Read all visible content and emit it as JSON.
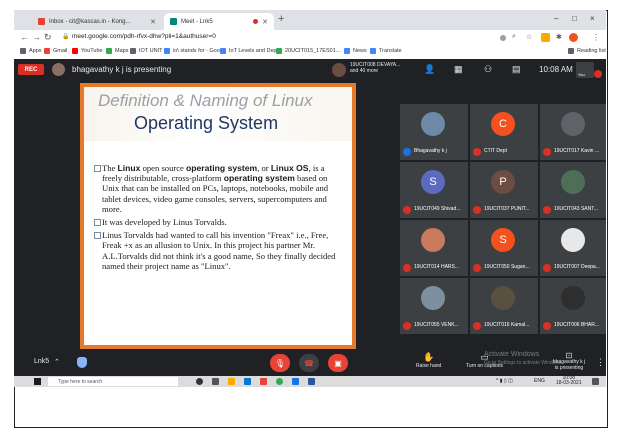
{
  "tabs": {
    "inactive_label": "Inbox - cit@kascas.in - Kong...",
    "active_label": "Meet - Lnk5"
  },
  "browser": {
    "url": "meet.google.com/pdh-rfvx-dhw?pli=1&authuser=0",
    "window_controls": [
      "–",
      "□",
      "×"
    ]
  },
  "bookmarks": [
    {
      "label": "Apps",
      "color": "#5f6368"
    },
    {
      "label": "Gmail",
      "color": "#ea4335"
    },
    {
      "label": "YouTube",
      "color": "#ff0000"
    },
    {
      "label": "Maps",
      "color": "#34a853"
    },
    {
      "label": "IOT UNIT 1",
      "color": "#5f6368"
    },
    {
      "label": "io\\ stands for - Goo...",
      "color": "#4285f4"
    },
    {
      "label": "IoT Levels and Depl...",
      "color": "#4285f4"
    },
    {
      "label": "20UCIT015_17ES01...",
      "color": "#34a853"
    },
    {
      "label": "News",
      "color": "#4285f4"
    },
    {
      "label": "Translate",
      "color": "#4285f4"
    },
    {
      "label": "Reading list",
      "color": "#5f6368"
    }
  ],
  "meet_top": {
    "rec_label": "REC",
    "presenting_text": "bhagavathy k j is presenting",
    "pinned_name_line1": "19UCIT008 DEVAYA...",
    "pinned_name_line2": "and 40 more",
    "clock": "10:08 AM",
    "you_label": "You"
  },
  "slide": {
    "title_line1": "Definition & Naming of Linux",
    "title_line2": "Operating System",
    "bullets": [
      "The <b>Linux</b> open source <b>operating system</b>, or <b>Linux OS</b>, is a freely distributable, cross-platform <b>operating system</b> based on Unix that can be installed on PCs, laptops, notebooks, mobile and tablet devices, video game consoles, servers, supercomputers and more.",
      "It was developed by Linus Torvalds.",
      "Linus Torvalds had wanted to call his invention \"Freax\" i.e., Free, Freak +x as an allusion to Unix. In this project his partner Mr. A.L.Torvalds did not think it's a good name, So they finally decided named their project name as \"Linux\"."
    ]
  },
  "participants": [
    {
      "name": "Bhagavathy k j",
      "initial": "",
      "avatar_color": "#6d8aa8",
      "mic_on": true
    },
    {
      "name": "CTIT Dept",
      "initial": "C",
      "avatar_color": "#f4511e",
      "mic_on": false
    },
    {
      "name": "19UCIT017 Kavin ...",
      "initial": "",
      "avatar_color": "#5f6368",
      "mic_on": false
    },
    {
      "name": "19UCIT049 Shivad...",
      "initial": "S",
      "avatar_color": "#5c6bc0",
      "mic_on": false
    },
    {
      "name": "19UCIT037 PUNIT...",
      "initial": "P",
      "avatar_color": "#6d4c41",
      "mic_on": false
    },
    {
      "name": "19UCIT043 SANT...",
      "initial": "",
      "avatar_color": "#4e6e58",
      "mic_on": false
    },
    {
      "name": "19UCIT014 HARS...",
      "initial": "",
      "avatar_color": "#c97a5c",
      "mic_on": false
    },
    {
      "name": "19UCIT050 Sugan...",
      "initial": "S",
      "avatar_color": "#f4511e",
      "mic_on": false
    },
    {
      "name": "19UCIT007 Deepa...",
      "initial": "",
      "avatar_color": "#e8e8e8",
      "mic_on": false
    },
    {
      "name": "19UCIT055 VENK...",
      "initial": "",
      "avatar_color": "#7d8fa0",
      "mic_on": false
    },
    {
      "name": "19UCIT016 Kamal...",
      "initial": "",
      "avatar_color": "#5a5040",
      "mic_on": false
    },
    {
      "name": "19UCIT006 BHAR...",
      "initial": "",
      "avatar_color": "#2e2e2e",
      "mic_on": false
    }
  ],
  "meet_bottom": {
    "meeting_code": "Lnk5",
    "raise_hand_label": "Raise hand",
    "captions_label": "Turn on captions",
    "watermark_line1": "Activate Windows",
    "watermark_line2": "Go to Settings to activate Windows.",
    "presenting_line1": "bhagavathy k j",
    "presenting_line2": "is presenting"
  },
  "taskbar": {
    "search_placeholder": "Type here to search",
    "lang": "ENG",
    "time": "10:08",
    "date": "18-03-2021"
  },
  "colors": {
    "meet_bg": "#202124",
    "tile_bg": "#3c4043",
    "end_call": "#ea4335",
    "slide_border": "#e57b2a",
    "slide_title": "#1f3864"
  }
}
